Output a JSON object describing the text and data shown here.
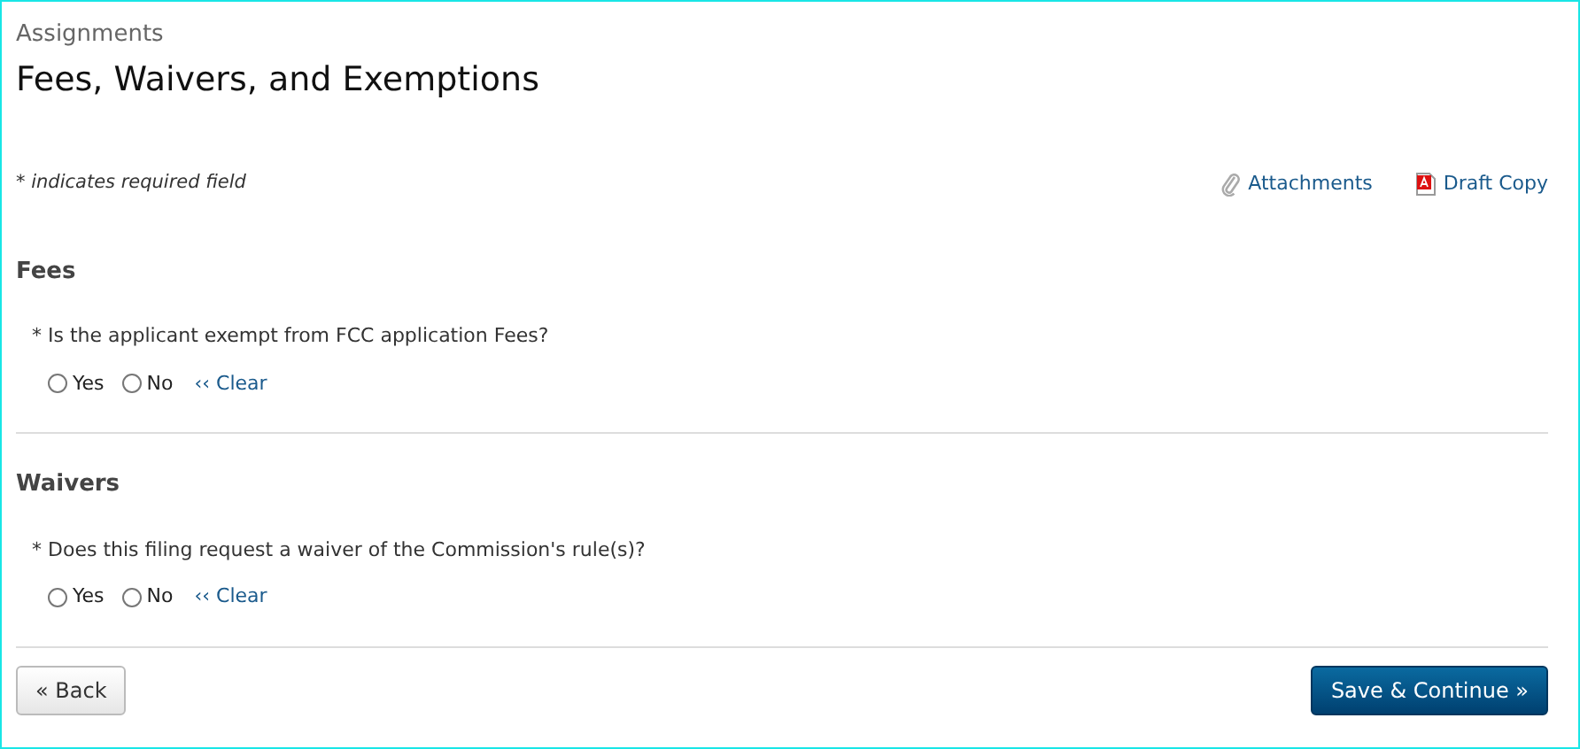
{
  "breadcrumb": "Assignments",
  "title": "Fees, Waivers, and Exemptions",
  "required_note": "* indicates required field",
  "links": [
    {
      "kind": "attachments",
      "label": "Attachments"
    },
    {
      "kind": "pdf",
      "label": "Draft Copy"
    }
  ],
  "sections": [
    {
      "heading": "Fees",
      "question": "* Is the applicant exempt from FCC application Fees?",
      "options": [
        {
          "label": "Yes",
          "selected": false
        },
        {
          "label": "No",
          "selected": false
        }
      ],
      "clear": "‹‹ Clear"
    },
    {
      "heading": "Waivers",
      "question": "* Does this filing request a waiver of the Commission's rule(s)?",
      "options": [
        {
          "label": "Yes",
          "selected": false
        },
        {
          "label": "No",
          "selected": false
        }
      ],
      "clear": "‹‹ Clear"
    }
  ],
  "buttons": {
    "back": "« Back",
    "next": "Save & Continue »"
  }
}
